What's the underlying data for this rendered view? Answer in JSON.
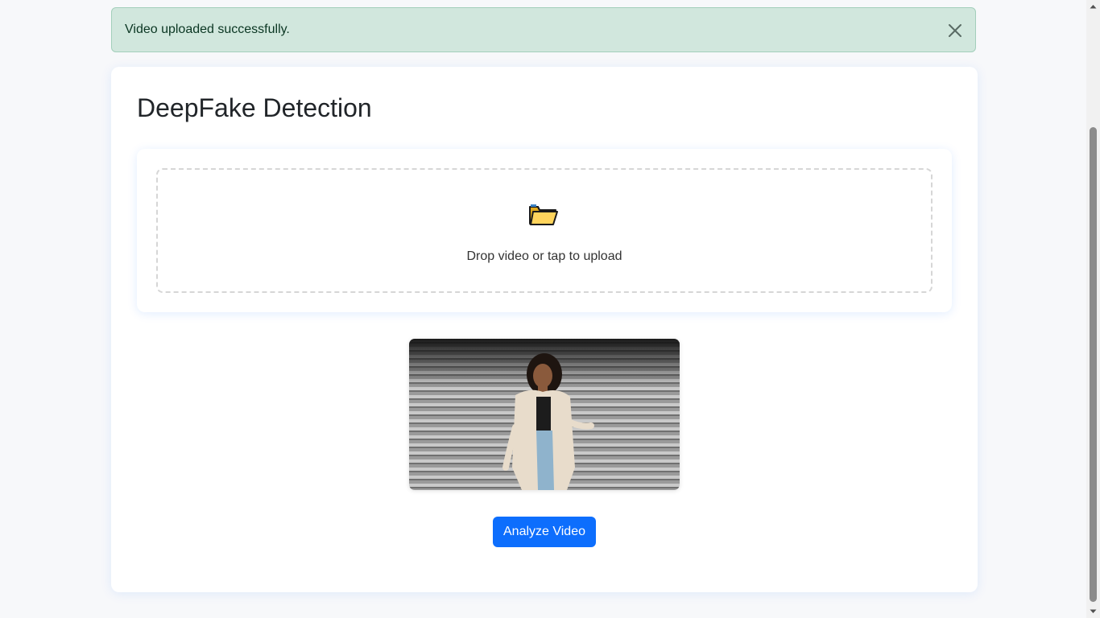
{
  "alert": {
    "message": "Video uploaded successfully.",
    "close_icon": "close-icon",
    "type": "success",
    "background_color": "#d1e7dd"
  },
  "page": {
    "title": "DeepFake Detection"
  },
  "upload": {
    "icon": "folder-icon",
    "prompt": "Drop video or tap to upload"
  },
  "video": {
    "thumbnail_description": "video preview thumbnail"
  },
  "actions": {
    "analyze_label": "Analyze Video",
    "analyze_color": "#0d6efd"
  }
}
